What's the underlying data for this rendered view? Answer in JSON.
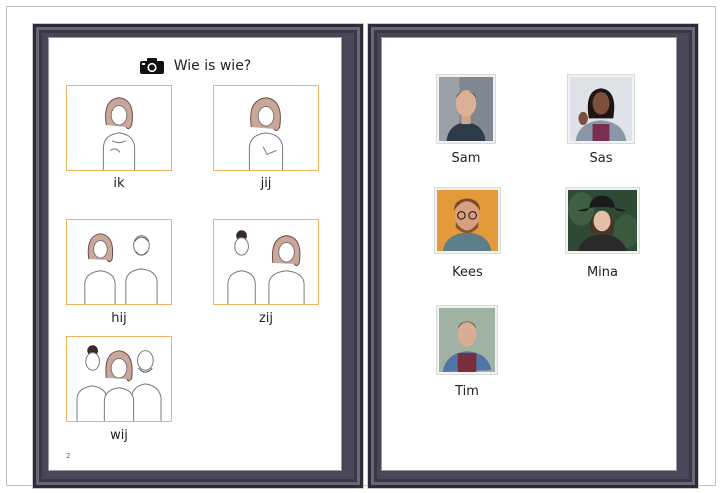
{
  "left_page": {
    "title": "Wie is wie?",
    "title_icon": "camera-icon",
    "page_number": "2",
    "pronouns": [
      {
        "label": "ik"
      },
      {
        "label": "jij"
      },
      {
        "label": "hij"
      },
      {
        "label": "zij"
      },
      {
        "label": "wij"
      }
    ]
  },
  "right_page": {
    "people": [
      {
        "name": "Sam"
      },
      {
        "name": "Sas"
      },
      {
        "name": "Kees"
      },
      {
        "name": "Mina"
      },
      {
        "name": "Tim"
      }
    ]
  },
  "colors": {
    "frame": "#4a4657",
    "picture_border": "#f0b45e",
    "paper": "#ffffff"
  }
}
